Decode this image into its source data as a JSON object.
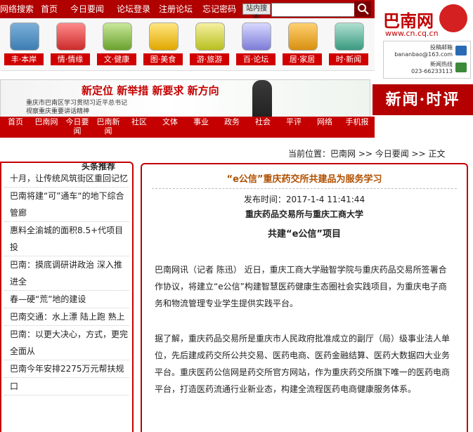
{
  "topbar": {
    "links": [
      "网络搜索",
      "首页",
      "今日要闻",
      "论坛登录",
      "注册论坛",
      "忘记密码"
    ],
    "search_button": "站内搜索",
    "search_placeholder": ""
  },
  "tiles": [
    {
      "label": "丰·本岸"
    },
    {
      "label": "情·情缘"
    },
    {
      "label": "文·健康"
    },
    {
      "label": "图·美食"
    },
    {
      "label": "游·旅游"
    },
    {
      "label": "百·论坛"
    },
    {
      "label": "居·家居"
    },
    {
      "label": "时·新闻"
    }
  ],
  "logo": {
    "name": "巴南网",
    "url": "www.cn.cq.cn"
  },
  "contact": {
    "email_label": "投稿邮箱",
    "email": "bananbao@163.com",
    "phone_label": "新闻热线",
    "phone": "023-66233113"
  },
  "banner": {
    "slogan": "新定位 新举措 新要求 新方向",
    "line1": "重庆市巴南区学习贯彻习近平总书记",
    "line2": "视察重庆重要讲话精神"
  },
  "section_tag": "新闻·时评",
  "channel_nav": [
    "首页",
    "巴南网",
    "今日要闻",
    "巴南新闻",
    "社区",
    "文体",
    "事业",
    "政务",
    "社会",
    "平评",
    "网络",
    "手机报"
  ],
  "breadcrumb": "当前位置：巴南网 >> 今日要闻 >> 正文",
  "article": {
    "title": "“e公信”重庆药交所共建品为服务学习",
    "publish_time": "发布时间：2017-1-4 11:41:44",
    "subtitle1": "重庆药品交易所与重庆工商大学",
    "subtitle2": "共建“e公信”项目",
    "paragraphs": [
      "巴南网讯（记者 陈迅） 近日，重庆工商大学融智学院与重庆药品交易所签署合作协议，将建立“e公信”构建智慧医药健康生态圈社会实践项目，为重庆电子商务和物流管理专业学生提供实践平台。",
      "据了解，重庆药品交易所是重庆市人民政府批准成立的副厅（局）级事业法人单位，先后建成药交所公共交易、医药电商、医药金融结算、医药大数据四大业务平台。重庆医药公信网是药交所官方网站，作为重庆药交所旗下唯一的医药电商平台，打造医药流通行业新业态，构建全流程医药电商健康服务体系。"
    ]
  },
  "sidebar": {
    "title": "头条推荐",
    "items": [
      "十月，让传统风筑街区重回记忆",
      "巴南将建“可”通车“的地下综合管廊",
      "惠料全渝城的面积8.5+代项目投",
      "巴南：摸底调研讲政治 深入推进全",
      "春—硬“荒”地的建设",
      "巴南交通：水上漂 陆上跑 熟上",
      "巴南：以更大决心，方式，更完全面从",
      "巴南今年安排2275万元帮扶规",
      "口"
    ]
  }
}
